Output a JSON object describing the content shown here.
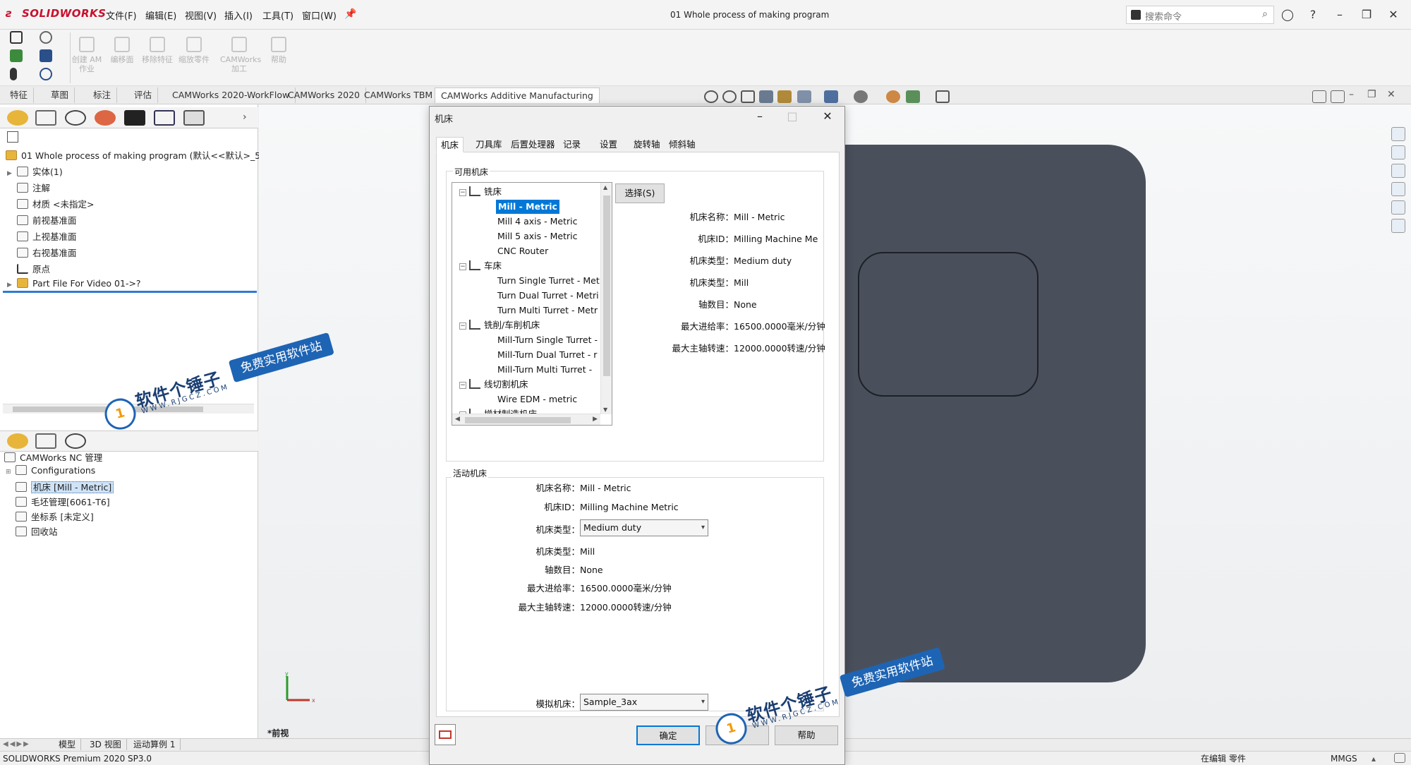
{
  "app": {
    "logo_text": "SOLIDWORKS",
    "document_title": "01 Whole process of making program",
    "menu": [
      "文件(F)",
      "编辑(E)",
      "视图(V)",
      "插入(I)",
      "工具(T)",
      "窗口(W)"
    ],
    "search_placeholder": "搜索命令"
  },
  "command_buttons": [
    "创建 AM 作业",
    "编移面",
    "移除特征",
    "缩放零件",
    "CAMWorks 加工",
    "帮助"
  ],
  "command_tabs": [
    "特征",
    "草图",
    "标注",
    "评估",
    "CAMWorks 2020-WorkFlow",
    "CAMWorks 2020",
    "CAMWorks TBM",
    "CAMWorks Additive Manufacturing"
  ],
  "feature_tree": {
    "root": "01 Whole process of making program  (默认<<默认>_5",
    "items": [
      "实体(1)",
      "注解",
      "材质 <未指定>",
      "前视基准面",
      "上视基准面",
      "右视基准面",
      "原点",
      "Part File For Video 01->?"
    ]
  },
  "nc_tree": {
    "root": "CAMWorks NC 管理",
    "items": [
      "Configurations",
      "机床 [Mill - Metric]",
      "毛坯管理[6061-T6]",
      "坐标系 [未定义]",
      "回收站"
    ]
  },
  "viewport": {
    "view_label": "*前视",
    "triad_x": "x",
    "triad_y": "y"
  },
  "bottom_tabs": [
    "模型",
    "3D 视图",
    "运动算例 1"
  ],
  "status": {
    "left": "SOLIDWORKS Premium 2020 SP3.0",
    "editing": "在编辑 零件",
    "units": "MMGS"
  },
  "dialog": {
    "title": "机床",
    "tabs": [
      "机床",
      "刀具库",
      "后置处理器",
      "记录",
      "设置",
      "旋转轴",
      "倾斜轴"
    ],
    "available_group": "可用机床",
    "select_button": "选择(S)",
    "machine_tree": [
      {
        "type": "category",
        "label": "铣床"
      },
      {
        "type": "item",
        "label": "Mill - Metric",
        "selected": true
      },
      {
        "type": "item",
        "label": "Mill 4 axis - Metric"
      },
      {
        "type": "item",
        "label": "Mill 5 axis - Metric"
      },
      {
        "type": "item",
        "label": "CNC Router"
      },
      {
        "type": "category",
        "label": "车床"
      },
      {
        "type": "item",
        "label": "Turn Single Turret - Met"
      },
      {
        "type": "item",
        "label": "Turn Dual Turret - Metri"
      },
      {
        "type": "item",
        "label": "Turn Multi Turret - Metr"
      },
      {
        "type": "category",
        "label": "铣削/车削机床"
      },
      {
        "type": "item",
        "label": "Mill-Turn Single Turret -"
      },
      {
        "type": "item",
        "label": "Mill-Turn Dual Turret - r"
      },
      {
        "type": "item",
        "label": "Mill-Turn Multi Turret -"
      },
      {
        "type": "category",
        "label": "线切割机床"
      },
      {
        "type": "item",
        "label": "Wire EDM - metric"
      },
      {
        "type": "category",
        "label": "增材制造机床"
      }
    ],
    "preview": [
      {
        "k": "机床名称：",
        "v": "Mill - Metric"
      },
      {
        "k": "机床ID：",
        "v": "Milling Machine Me"
      },
      {
        "k": "机床类型：",
        "v": "Medium duty"
      },
      {
        "k": "机床类型：",
        "v": "Mill"
      },
      {
        "k": "轴数目：",
        "v": "None"
      },
      {
        "k": "最大进给率：",
        "v": "16500.0000毫米/分钟"
      },
      {
        "k": "最大主轴转速：",
        "v": "12000.0000转速/分钟"
      }
    ],
    "active_group": "活动机床",
    "active": {
      "name_k": "机床名称：",
      "name_v": "Mill - Metric",
      "id_k": "机床ID：",
      "id_v": "Milling Machine Metric",
      "type_k": "机床类型：",
      "type_v": "Medium duty",
      "type2_k": "机床类型：",
      "type2_v": "Mill",
      "axes_k": "轴数目：",
      "axes_v": "None",
      "feed_k": "最大进给率：",
      "feed_v": "16500.0000毫米/分钟",
      "spindle_k": "最大主轴转速：",
      "spindle_v": "12000.0000转速/分钟"
    },
    "sim_label": "模拟机床：",
    "sim_value": "Sample_3ax",
    "ok": "确定",
    "cancel": "",
    "help": "帮助"
  },
  "watermark": {
    "main": "软件个锤子",
    "tag": "免费实用软件站",
    "url": "WWW.RJGCZ.COM"
  }
}
